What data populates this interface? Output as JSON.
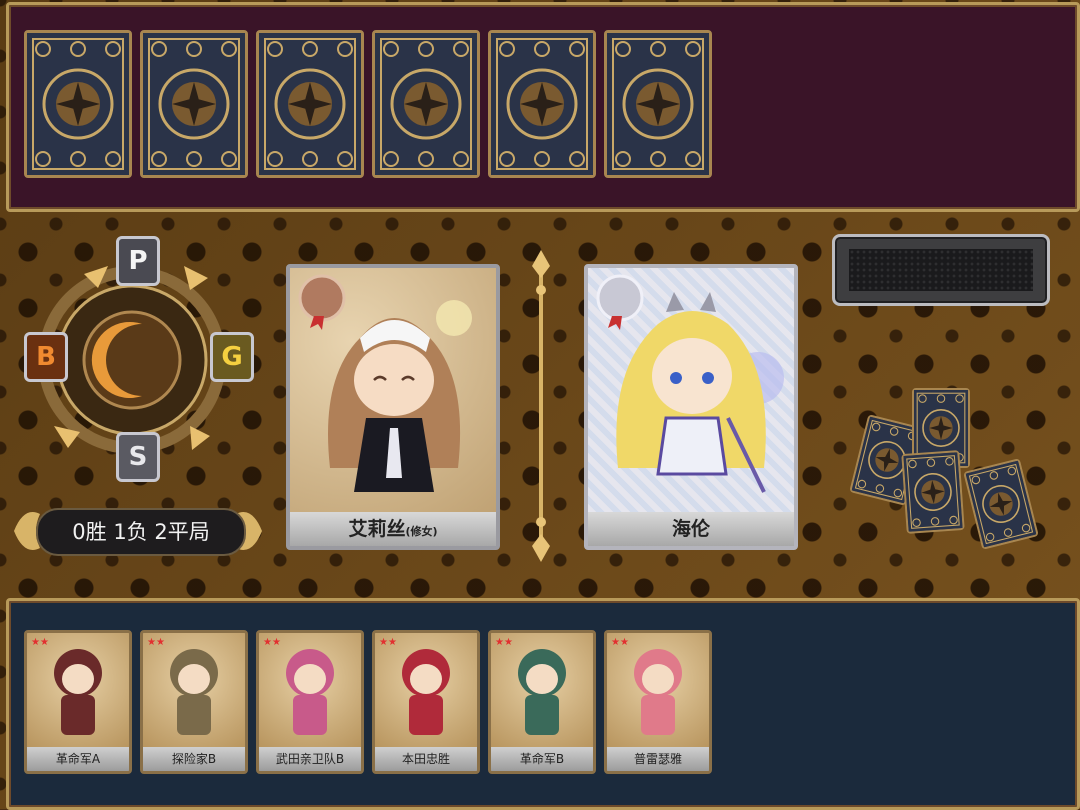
{
  "opponent_hand": {
    "count": 6
  },
  "record": {
    "text": "0胜 1负 2平局"
  },
  "wheel": {
    "letters": [
      "P",
      "G",
      "S",
      "B"
    ]
  },
  "battle": {
    "player_card": {
      "name": "艾莉丝",
      "sub": "(修女)",
      "rarity": "bronze"
    },
    "enemy_card": {
      "name": "海伦",
      "rarity": "silver"
    }
  },
  "scoreboard": {
    "text": ""
  },
  "player_hand": [
    {
      "label": "革命军A",
      "stars": "★★"
    },
    {
      "label": "探险家B",
      "stars": "★★"
    },
    {
      "label": "武田亲卫队B",
      "stars": "★★"
    },
    {
      "label": "本田忠胜",
      "stars": "★★"
    },
    {
      "label": "革命军B",
      "stars": "★★"
    },
    {
      "label": "普雷瑟雅",
      "stars": "★★"
    }
  ],
  "colors": {
    "accent": "#c8a868",
    "top_panel": "#3a1428",
    "bottom_panel": "#1b2a3c"
  }
}
